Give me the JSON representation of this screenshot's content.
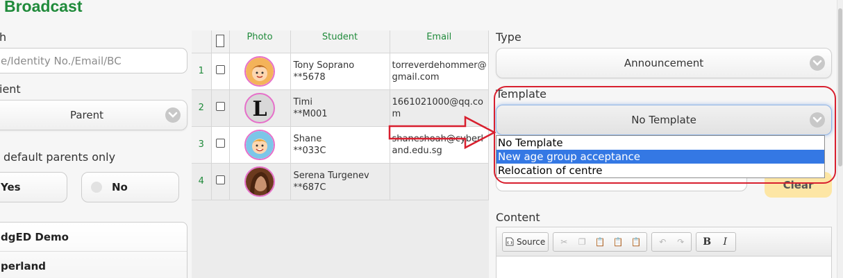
{
  "page": {
    "title": "Broadcast"
  },
  "filters": {
    "search_label": "h",
    "search_placeholder": "e/Identity No./Email/BC",
    "recipient_label": "ient",
    "recipient_value": "Parent",
    "default_parents_label": "default parents only",
    "yes_label": "Yes",
    "no_label": "No",
    "schools": [
      "dgED Demo",
      "perland"
    ]
  },
  "table": {
    "columns": [
      "Photo",
      "Student",
      "Email"
    ],
    "rows": [
      {
        "num": "1",
        "name": "Tony Soprano",
        "id": "**5678",
        "email": "torreverdehommer@gmail.com",
        "avatar": "girl-cartoon-avatar"
      },
      {
        "num": "2",
        "name": "Timi",
        "id": "**M001",
        "email": "1661021000@qq.com",
        "avatar": "letter-l-avatar"
      },
      {
        "num": "3",
        "name": "Shane",
        "id": "**033C",
        "email": "shaneshoah@cyberland.edu.sg",
        "avatar": "boy-cartoon-avatar"
      },
      {
        "num": "4",
        "name": "Serena Turgenev",
        "id": "**687C",
        "email": "",
        "avatar": "photo-avatar"
      }
    ]
  },
  "form": {
    "type_label": "Type",
    "type_value": "Announcement",
    "template_label": "Template",
    "template_value": "No Template",
    "template_options": [
      "No Template",
      "New age group acceptance",
      "Relocation of centre"
    ],
    "template_selected_index": 1,
    "clear_label": "Clear",
    "content_label": "Content",
    "source_label": "Source",
    "bold_label": "B",
    "italic_label": "I"
  },
  "colors": {
    "title_green": "#1f8a3a",
    "highlight_red": "#d81f2e",
    "selection_blue": "#3478e4",
    "clear_yellow": "#fde6a5"
  }
}
